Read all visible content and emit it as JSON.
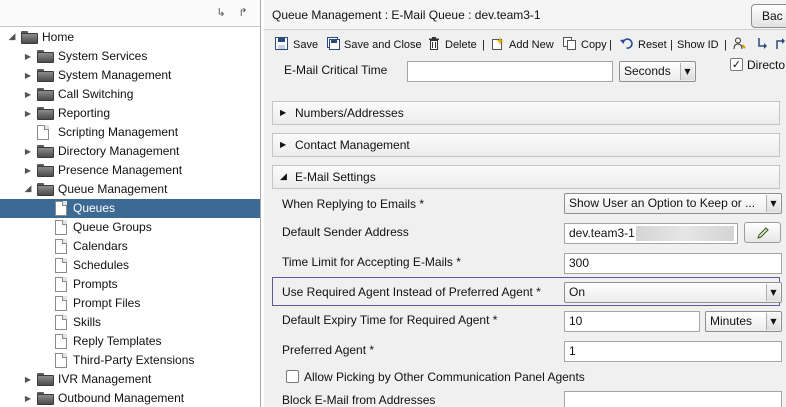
{
  "tree": {
    "items": [
      {
        "label": "Home",
        "kind": "folder",
        "level": 0,
        "toggle": "open"
      },
      {
        "label": "System Services",
        "kind": "folder",
        "level": 1,
        "toggle": "closed"
      },
      {
        "label": "System Management",
        "kind": "folder",
        "level": 1,
        "toggle": "closed"
      },
      {
        "label": "Call Switching",
        "kind": "folder",
        "level": 1,
        "toggle": "closed"
      },
      {
        "label": "Reporting",
        "kind": "folder",
        "level": 1,
        "toggle": "closed"
      },
      {
        "label": "Scripting Management",
        "kind": "doc",
        "level": 1,
        "toggle": "none"
      },
      {
        "label": "Directory Management",
        "kind": "folder",
        "level": 1,
        "toggle": "closed"
      },
      {
        "label": "Presence Management",
        "kind": "folder",
        "level": 1,
        "toggle": "closed"
      },
      {
        "label": "Queue Management",
        "kind": "folder",
        "level": 1,
        "toggle": "open"
      },
      {
        "label": "Queues",
        "kind": "doc",
        "level": 2,
        "toggle": "none",
        "selected": true
      },
      {
        "label": "Queue Groups",
        "kind": "doc",
        "level": 2,
        "toggle": "none"
      },
      {
        "label": "Calendars",
        "kind": "doc",
        "level": 2,
        "toggle": "none"
      },
      {
        "label": "Schedules",
        "kind": "doc",
        "level": 2,
        "toggle": "none"
      },
      {
        "label": "Prompts",
        "kind": "doc",
        "level": 2,
        "toggle": "none"
      },
      {
        "label": "Prompt Files",
        "kind": "doc",
        "level": 2,
        "toggle": "none"
      },
      {
        "label": "Skills",
        "kind": "doc",
        "level": 2,
        "toggle": "none"
      },
      {
        "label": "Reply Templates",
        "kind": "doc",
        "level": 2,
        "toggle": "none"
      },
      {
        "label": "Third-Party Extensions",
        "kind": "doc",
        "level": 2,
        "toggle": "none"
      },
      {
        "label": "IVR Management",
        "kind": "folder",
        "level": 1,
        "toggle": "closed"
      },
      {
        "label": "Outbound Management",
        "kind": "folder",
        "level": 1,
        "toggle": "closed"
      }
    ]
  },
  "left_toolbar": {
    "expand_glyph": "↳",
    "collapse_glyph": "↱"
  },
  "header": {
    "title": "Queue Management : E-Mail Queue : dev.team3-1",
    "back_label": "Bac"
  },
  "toolbar": {
    "save": "Save",
    "save_close": "Save and Close",
    "delete": "Delete",
    "add_new": "Add New",
    "copy": "Copy",
    "reset": "Reset",
    "show_id": "Show ID",
    "separator": "|"
  },
  "form": {
    "email_critical_time": {
      "label": "E-Mail Critical Time",
      "value": "",
      "unit": "Seconds"
    },
    "directory_checkbox": {
      "label": "Directo",
      "checked": true
    },
    "sections": {
      "numbers": "Numbers/Addresses",
      "contact": "Contact Management",
      "email_settings": "E-Mail Settings"
    },
    "replying": {
      "label": "When Replying to Emails *",
      "value": "Show User an Option to Keep or ..."
    },
    "sender": {
      "label": "Default Sender Address",
      "value": "dev.team3-1"
    },
    "time_limit": {
      "label": "Time Limit for Accepting E-Mails *",
      "value": "300"
    },
    "required_agent": {
      "label": "Use Required Agent Instead of Preferred Agent *",
      "value": "On"
    },
    "expiry": {
      "label": "Default Expiry Time for Required Agent *",
      "value": "10",
      "unit": "Minutes"
    },
    "preferred_agent": {
      "label": "Preferred Agent *",
      "value": "1"
    },
    "allow_picking": {
      "label": "Allow Picking by Other Communication Panel Agents",
      "checked": false
    },
    "block_email": {
      "label": "Block E-Mail from Addresses",
      "value": ""
    }
  },
  "glyphs": {
    "dropdown": "▼",
    "check": "✓",
    "expanded": "◢",
    "collapsed": "▶",
    "tree_open": "◢",
    "tree_closed": "▶"
  }
}
